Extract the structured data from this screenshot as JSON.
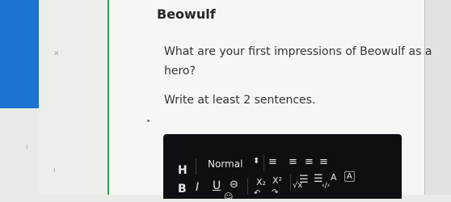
{
  "question": {
    "title": "Beowulf",
    "line1": "What are your first impressions of Beowulf as a",
    "line2": "hero?",
    "instruction": "Write at least 2 sentences."
  },
  "toolbar": {
    "heading_label": "H",
    "style_value": "Normal",
    "bold_label": "B",
    "italic_label": "I",
    "underline_label": "U",
    "subscript_label": "X₂",
    "superscript_label": "X²",
    "font_color_label": "A",
    "highlight_label": "A",
    "formula_label": "√x",
    "code_label": "‹/›"
  },
  "colors": {
    "accent": "#1b73d2",
    "rule": "#2fa34f",
    "toolbar_bg": "#0d0f12"
  },
  "icons": [
    "strikethrough-icon",
    "align-left-icon",
    "align-center-icon",
    "align-right-icon",
    "align-justify-icon",
    "numbered-list-icon",
    "bulleted-list-icon",
    "undo-icon",
    "redo-icon"
  ]
}
